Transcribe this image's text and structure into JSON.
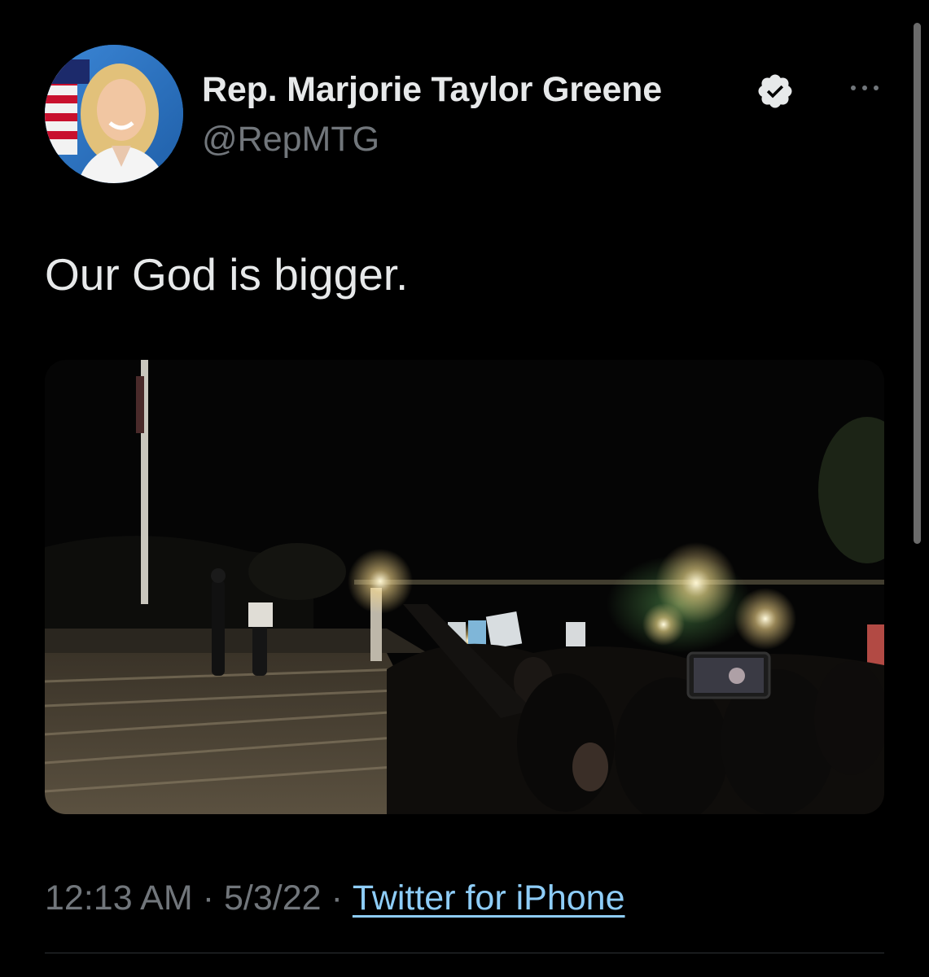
{
  "tweet": {
    "author": {
      "display_name": "Rep. Marjorie Taylor Greene",
      "handle": "@RepMTG",
      "verified": true,
      "avatar_icon": "profile-photo"
    },
    "text": "Our God is bigger.",
    "media": {
      "type": "video",
      "icon": "night-protest-video-frame"
    },
    "time": "12:13 AM",
    "date": "5/3/22",
    "source": "Twitter for iPhone",
    "separator": "·"
  },
  "icons": {
    "verified": "verified-badge-icon",
    "more": "more-options-icon"
  },
  "colors": {
    "background": "#000000",
    "primary_text": "#e7e9ea",
    "secondary_text": "#71767b",
    "link": "#8ecdf8",
    "divider": "#2f3336"
  }
}
